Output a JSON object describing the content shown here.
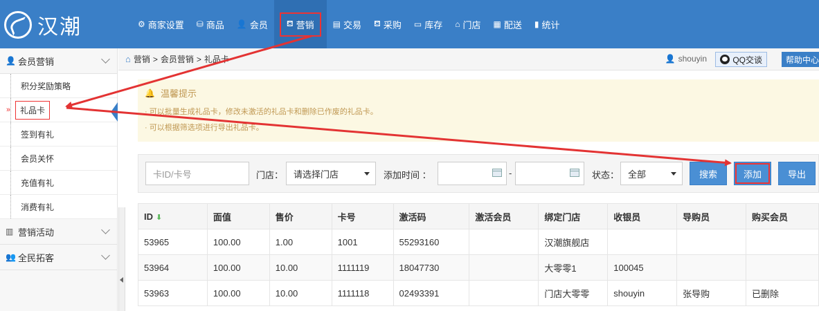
{
  "app": {
    "logo_text": "汉潮"
  },
  "nav": [
    {
      "label": "商家设置",
      "icon": "gear-icon",
      "glyph": "⚙",
      "active": false
    },
    {
      "label": "商品",
      "icon": "goods-icon",
      "glyph": "⛁",
      "active": false
    },
    {
      "label": "会员",
      "icon": "user-icon",
      "glyph": "👤",
      "active": false
    },
    {
      "label": "营销",
      "icon": "cup-icon",
      "glyph": "⛾",
      "active": true
    },
    {
      "label": "交易",
      "icon": "document-icon",
      "glyph": "▤",
      "active": false
    },
    {
      "label": "采购",
      "icon": "cup-icon",
      "glyph": "⛾",
      "active": false
    },
    {
      "label": "库存",
      "icon": "box-icon",
      "glyph": "▭",
      "active": false
    },
    {
      "label": "门店",
      "icon": "home-icon",
      "glyph": "⌂",
      "active": false
    },
    {
      "label": "配送",
      "icon": "truck-icon",
      "glyph": "▦",
      "active": false
    },
    {
      "label": "统计",
      "icon": "bar-chart-icon",
      "glyph": "▮",
      "active": false
    }
  ],
  "sidebar": {
    "group1": "会员营销",
    "items": [
      "积分奖励策略",
      "礼品卡",
      "签到有礼",
      "会员关怀",
      "充值有礼",
      "消费有礼"
    ],
    "group2": "营销活动",
    "group3": "全民拓客"
  },
  "breadcrumb": {
    "l1": "营销",
    "l2": "会员营销",
    "l3": "礼品卡",
    "sep": ">"
  },
  "user": {
    "name": "shouyin",
    "qq": "QQ交谈",
    "help": "帮助中心"
  },
  "notice": {
    "title": "温馨提示",
    "lines": [
      "· 可以批量生成礼品卡，修改未激活的礼品卡和删除已作废的礼品卡。",
      "· 可以根据筛选项进行导出礼品卡。"
    ]
  },
  "filter": {
    "card_placeholder": "卡ID/卡号",
    "store_label": "门店：",
    "store_value": "请选择门店",
    "time_label": "添加时间 ：",
    "dash": "-",
    "status_label": "状态：",
    "status_value": "全部",
    "search": "搜索",
    "add": "添加",
    "export": "导出"
  },
  "table": {
    "headers": [
      "ID",
      "面值",
      "售价",
      "卡号",
      "激活码",
      "激活会员",
      "绑定门店",
      "收银员",
      "导购员",
      "购买会员"
    ],
    "rows": [
      [
        "53965",
        "100.00",
        "1.00",
        "1001",
        "55293160",
        "",
        "汉潮旗舰店",
        "",
        "",
        ""
      ],
      [
        "53964",
        "100.00",
        "10.00",
        "1111119",
        "18047730",
        "",
        "大零零1",
        "100045",
        "",
        ""
      ],
      [
        "53963",
        "100.00",
        "10.00",
        "1111118",
        "02493391",
        "",
        "门店大零零",
        "shouyin",
        "张导购",
        "已删除"
      ]
    ]
  },
  "colors": {
    "primary": "#3a7fc7",
    "highlight": "#e33333"
  }
}
